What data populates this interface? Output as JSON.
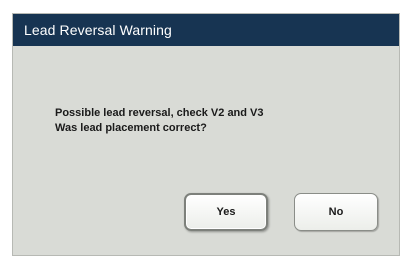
{
  "dialog": {
    "title": "Lead Reversal Warning",
    "message_line1": "Possible lead reversal, check V2 and V3",
    "message_line2": "Was lead placement correct?",
    "yes_label": "Yes",
    "no_label": "No"
  },
  "colors": {
    "titlebar": "#173452",
    "dialog_background": "#d9dbd6",
    "button_background": "#ffffff"
  }
}
